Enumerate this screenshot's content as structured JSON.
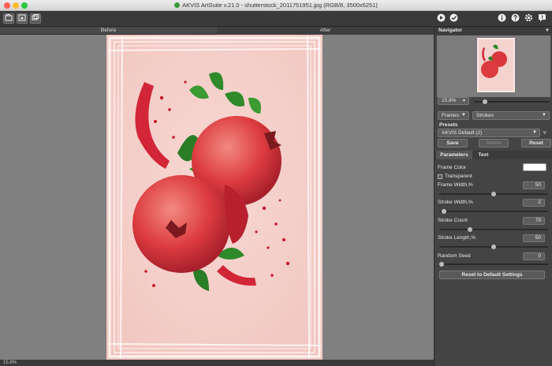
{
  "window": {
    "title": "AKVIS ArtSuite v.21.0 - shutterstock_2011751951.jpg (RGB/8, 3500x5251)"
  },
  "toolbar": {
    "left_icons": [
      "open-image-icon",
      "save-image-icon",
      "batch-icon"
    ],
    "right_icons": [
      "run-icon",
      "apply-icon",
      "info-icon",
      "help-icon",
      "settings-icon",
      "notifications-icon"
    ]
  },
  "view_tabs": {
    "before": "Before",
    "after": "After"
  },
  "status": {
    "zoom": "15.8%"
  },
  "navigator": {
    "title": "Navigator",
    "zoom": "15.8%",
    "zoom_fraction": 0.12
  },
  "effect": {
    "group": "Frames",
    "type": "Strokes"
  },
  "presets": {
    "label": "Presets",
    "selected": "AKVIS Default (2)",
    "save": "Save",
    "delete": "Delete",
    "reset": "Reset"
  },
  "tabs": {
    "parameters": "Parameters",
    "text": "Text"
  },
  "params": {
    "frame_color": {
      "label": "Frame Color",
      "color": "#ffffff"
    },
    "transparent": {
      "label": "Transparent",
      "checked": false
    },
    "frame_width": {
      "label": "Frame Width,%",
      "value": "50",
      "fraction": 0.5
    },
    "stroke_width": {
      "label": "Stroke Width,%",
      "value": "2",
      "fraction": 0.02
    },
    "stroke_count": {
      "label": "Stroke Count",
      "value": "79",
      "fraction": 0.27
    },
    "stroke_length": {
      "label": "Stroke Length,%",
      "value": "50",
      "fraction": 0.5
    },
    "random_seed": {
      "label": "Random Seed",
      "value": "0",
      "fraction": 0.0
    },
    "reset_defaults": "Reset to Default Settings"
  }
}
